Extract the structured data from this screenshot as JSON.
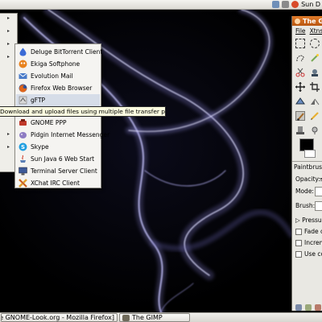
{
  "top_panel": {
    "date_text": "Sun D"
  },
  "taskbar": {
    "firefox_task": "uttle GNOME-Look.org - Mozilla Firefox]",
    "gimp_task": "The GIMP"
  },
  "submenu": {
    "items": [
      {
        "label": "Deluge BitTorrent Client",
        "icon": "deluge-icon",
        "color": "#3b6bd6"
      },
      {
        "label": "Ekiga Softphone",
        "icon": "ekiga-icon",
        "color": "#e8821e"
      },
      {
        "label": "Evolution Mail",
        "icon": "evolution-icon",
        "color": "#4a7bc8"
      },
      {
        "label": "Firefox Web Browser",
        "icon": "firefox-icon",
        "color": "#e0661b"
      },
      {
        "label": "gFTP",
        "icon": "gftp-icon",
        "color": "#d8d8d8"
      },
      {
        "label": "GNOME PPP",
        "icon": "gnome-ppp-icon",
        "color": "#c0392b"
      },
      {
        "label": "Pidgin Internet Messenger",
        "icon": "pidgin-icon",
        "color": "#8e7cc3"
      },
      {
        "label": "Skype",
        "icon": "skype-icon",
        "color": "#1e9ee0"
      },
      {
        "label": "Sun Java 6 Web Start",
        "icon": "java-icon",
        "color": "#5b7fb5"
      },
      {
        "label": "Terminal Server Client",
        "icon": "tsclient-icon",
        "color": "#3d5a99"
      },
      {
        "label": "XChat IRC Client",
        "icon": "xchat-icon",
        "color": "#e0a030"
      }
    ]
  },
  "tooltip": {
    "text": "Download and upload files using multiple file transfer protocols"
  },
  "gimp": {
    "title": "The G",
    "menu": [
      "File",
      "Xtns"
    ],
    "tool_options_title": "Paintbrush",
    "opacity_label": "Opacity:",
    "opacity_value": "≡",
    "mode_label": "Mode:",
    "brush_label": "Brush:",
    "pressure_label": "Pressu",
    "fade_label": "Fade o",
    "incremental_label": "Increm",
    "use_color_label": "Use co"
  }
}
